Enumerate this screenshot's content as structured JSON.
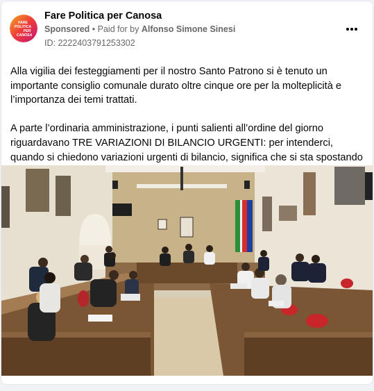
{
  "post": {
    "page_name": "Fare Politica per Canosa",
    "sponsored_label": "Sponsored",
    "separator": " • ",
    "paid_for_text": "Paid for by ",
    "sponsor_name": "Alfonso Simone Sinesi",
    "ad_id": "ID: 2222403791253302",
    "paragraph_1": "Alla vigilia dei festeggiamenti per il nostro Santo Patrono si è tenuto un importante consiglio comunale durato oltre cinque ore per la molteplicità e l’importanza dei temi trattati.",
    "paragraph_2": "A parte l’ordinaria amministrazione, i punti salienti all’ordine del giorno riguardavano TRE VARIAZIONI DI BILANCIO URGENTI: per intenderci, quando si chiedono variazioni urgenti di bilancio, significa che si sta spostando denaro da…"
  },
  "avatar_logo": {
    "line1": "FARE",
    "line2": "POLITICA",
    "line3": "PER",
    "line4": "CANOSA",
    "colors": {
      "gradient_start": "#f5a623",
      "gradient_mid": "#ee3a3a",
      "gradient_end": "#c3157a"
    }
  },
  "icons": {
    "more": "more-horizontal-icon"
  }
}
